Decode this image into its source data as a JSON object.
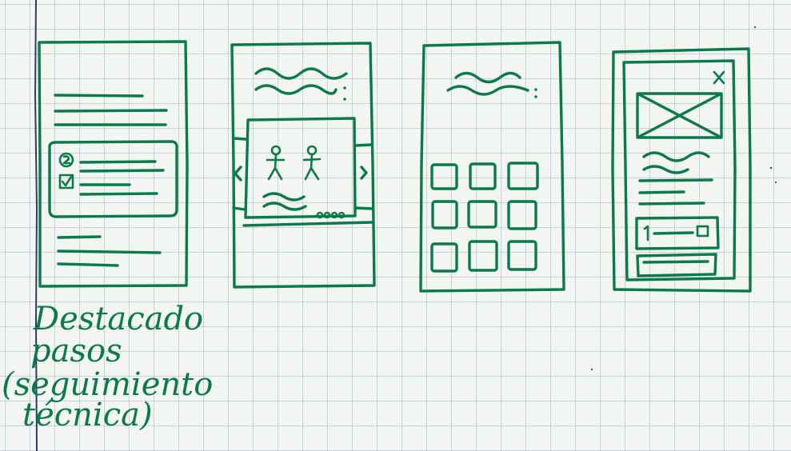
{
  "ink_color": "#0b7a4a",
  "paper_color": "#f3f5f2",
  "grid_color": "#8793b5",
  "caption": {
    "line1": "Destacado",
    "line2": "pasos",
    "line3": "(seguimiento",
    "line4": "técnica)"
  },
  "frames": [
    {
      "name": "steps-highlight-screen",
      "icons": [
        "step-number-icon",
        "checkbox-icon"
      ]
    },
    {
      "name": "carousel-screen",
      "icons": [
        "chevron-left-icon",
        "chevron-right-icon",
        "stick-figure-icon",
        "stick-figure-icon",
        "pagination-dots-icon"
      ]
    },
    {
      "name": "grid-screen",
      "icons": [
        "more-dots-icon"
      ]
    },
    {
      "name": "detail-modal-screen",
      "icons": [
        "close-icon",
        "image-placeholder-icon"
      ]
    }
  ]
}
